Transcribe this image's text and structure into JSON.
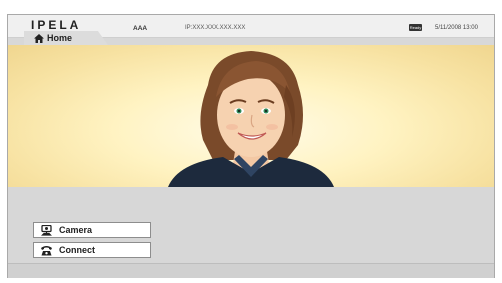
{
  "header": {
    "logo": "IPELA",
    "site_name": "AAA",
    "ip_address": "IP:XXX.XXX.XXX.XXX",
    "status_badge": "Ready",
    "datetime": "5/11/2008 13:00"
  },
  "tabs": {
    "home_label": "Home"
  },
  "buttons": {
    "camera_label": "Camera",
    "connect_label": "Connect"
  },
  "icons": {
    "home": "home-icon",
    "camera": "camera-icon",
    "connect": "phone-icon"
  },
  "colors": {
    "video_background": "#fff3c2",
    "panel": "#d7d7d7",
    "header": "#f0f0f0"
  }
}
